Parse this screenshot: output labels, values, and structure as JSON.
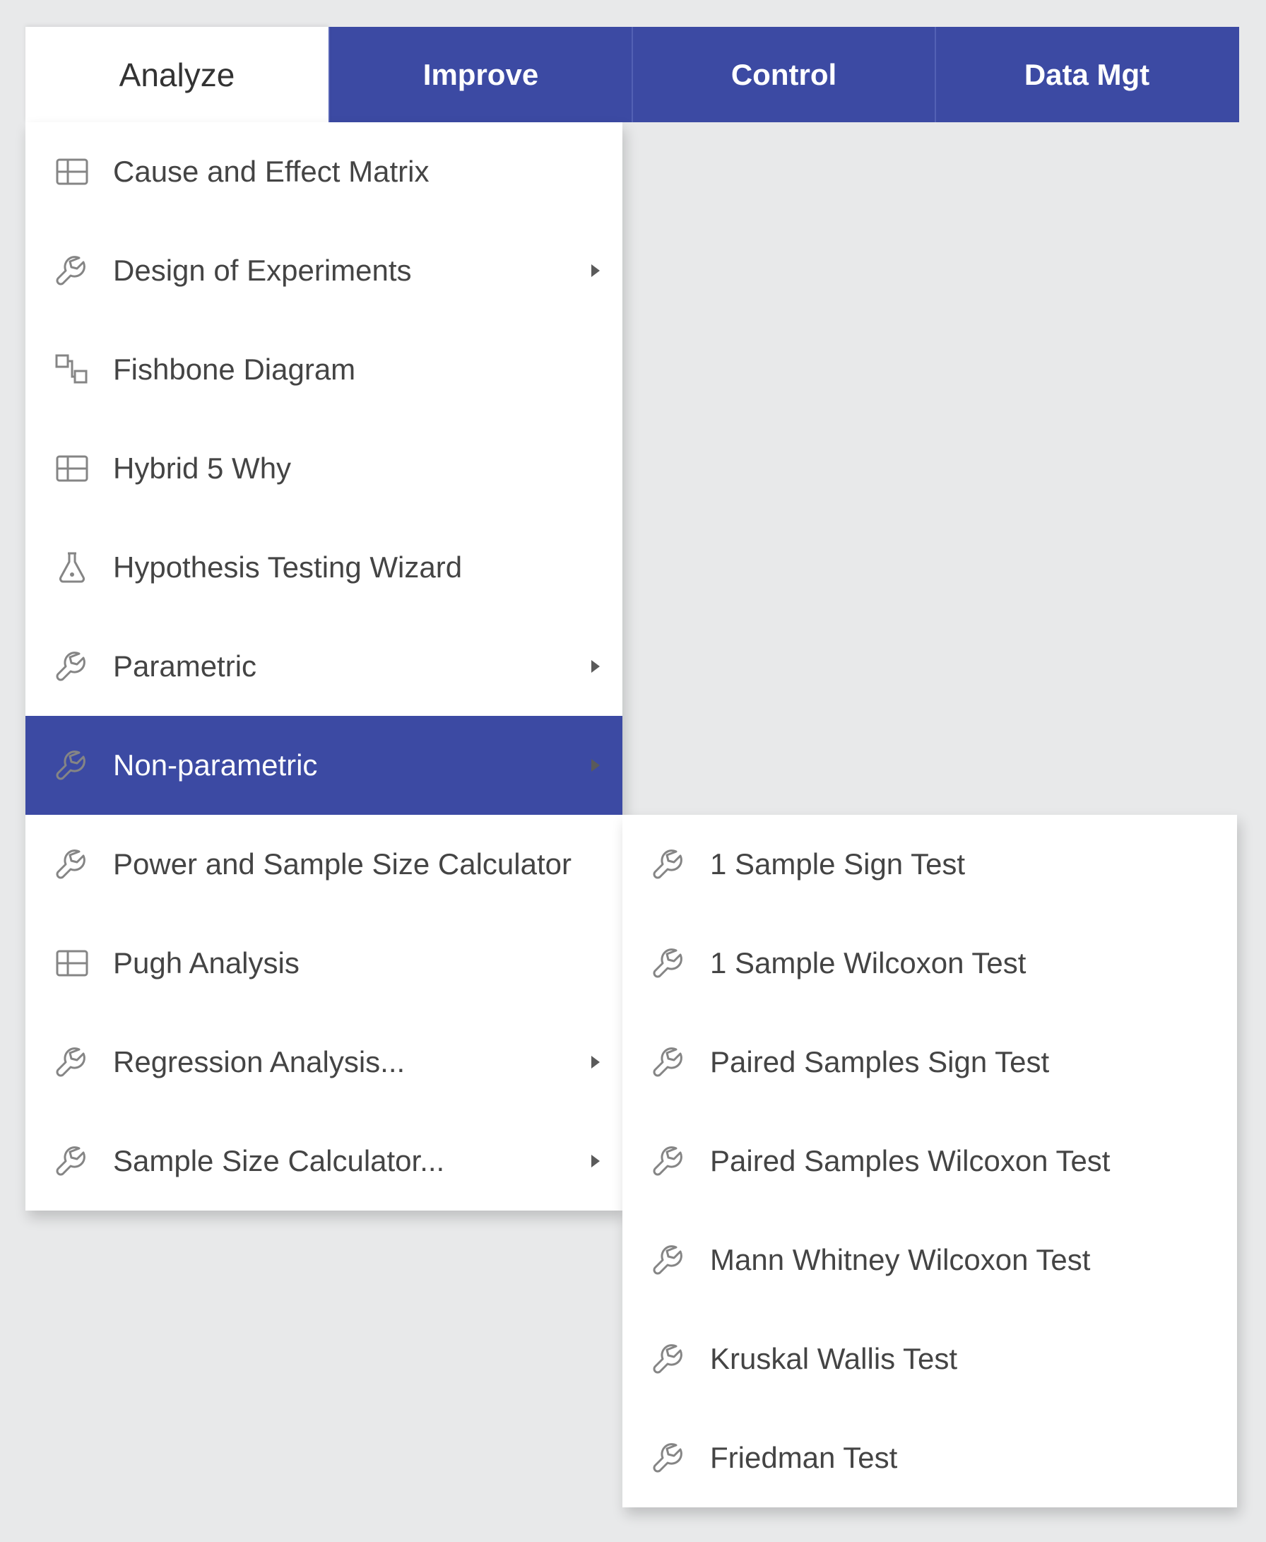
{
  "colors": {
    "accent": "#3c4aa3"
  },
  "tabs": [
    {
      "label": "Analyze",
      "active": true
    },
    {
      "label": "Improve",
      "active": false
    },
    {
      "label": "Control",
      "active": false
    },
    {
      "label": "Data Mgt",
      "active": false
    }
  ],
  "menu": [
    {
      "label": "Cause and Effect Matrix",
      "icon": "matrix",
      "submenu": false,
      "highlight": false
    },
    {
      "label": "Design of Experiments",
      "icon": "wrench",
      "submenu": true,
      "highlight": false
    },
    {
      "label": "Fishbone Diagram",
      "icon": "fishbone",
      "submenu": false,
      "highlight": false
    },
    {
      "label": "Hybrid 5 Why",
      "icon": "matrix",
      "submenu": false,
      "highlight": false
    },
    {
      "label": "Hypothesis Testing Wizard",
      "icon": "flask",
      "submenu": false,
      "highlight": false
    },
    {
      "label": "Parametric",
      "icon": "wrench",
      "submenu": true,
      "highlight": false
    },
    {
      "label": "Non-parametric",
      "icon": "wrench",
      "submenu": true,
      "highlight": true
    },
    {
      "label": "Power and Sample Size Calculator",
      "icon": "wrench",
      "submenu": false,
      "highlight": false
    },
    {
      "label": "Pugh Analysis",
      "icon": "matrix",
      "submenu": false,
      "highlight": false
    },
    {
      "label": "Regression Analysis...",
      "icon": "wrench",
      "submenu": true,
      "highlight": false
    },
    {
      "label": "Sample Size Calculator...",
      "icon": "wrench",
      "submenu": true,
      "highlight": false
    }
  ],
  "submenu": [
    {
      "label": "1 Sample Sign Test",
      "icon": "wrench"
    },
    {
      "label": "1 Sample Wilcoxon Test",
      "icon": "wrench"
    },
    {
      "label": "Paired Samples Sign Test",
      "icon": "wrench"
    },
    {
      "label": "Paired Samples Wilcoxon Test",
      "icon": "wrench"
    },
    {
      "label": "Mann Whitney Wilcoxon Test",
      "icon": "wrench"
    },
    {
      "label": "Kruskal Wallis Test",
      "icon": "wrench"
    },
    {
      "label": "Friedman Test",
      "icon": "wrench"
    }
  ]
}
